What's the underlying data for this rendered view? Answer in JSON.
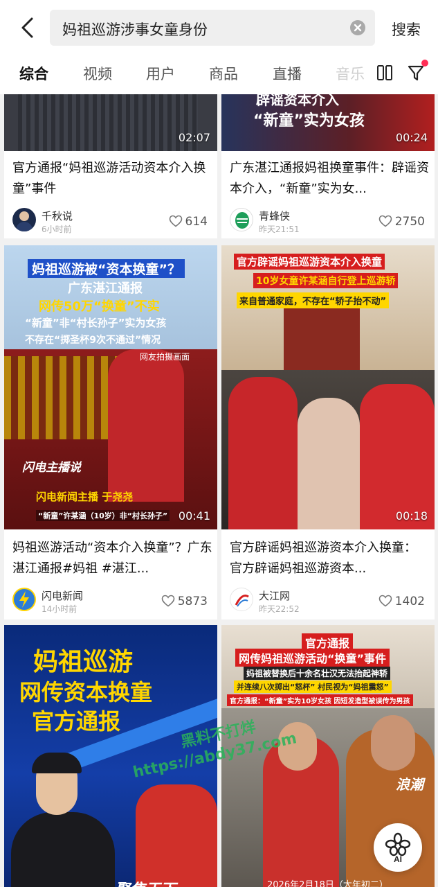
{
  "header": {
    "search_query": "妈祖巡游涉事女童身份",
    "search_button": "搜索"
  },
  "tabs": [
    "综合",
    "视频",
    "用户",
    "商品",
    "直播",
    "音乐"
  ],
  "cards": [
    {
      "duration": "02:07",
      "title": "官方通报“妈祖巡游活动资本介入换童”事件",
      "author": "千秋说",
      "time": "6小时前",
      "likes": "614"
    },
    {
      "duration": "00:24",
      "overlay": [
        "辟谣资本介入",
        "“新童”实为女孩"
      ],
      "title": "广东湛江通报妈祖换童事件：辟谣资本介入，“新童”实为女...",
      "author": "青蜂侠",
      "time": "昨天21:51",
      "likes": "2750"
    },
    {
      "duration": "00:41",
      "overlay": [
        "妈祖巡游被“资本换童”？",
        "广东湛江通报",
        "网传50万“换童”不实",
        "“新童”非“村长孙子”实为女孩",
        "不存在“掷圣杯9次不通过”情况",
        "网友拍摄画面",
        "闪电主播说",
        "闪电新闻主播 于尧尧",
        "“新童”许某涵（10岁）非“村长孙子”"
      ],
      "title": "妈祖巡游活动“资本介入换童”？广东湛江通报#妈祖 #湛江...",
      "author": "闪电新闻",
      "time": "14小时前",
      "likes": "5873"
    },
    {
      "duration": "00:18",
      "overlay": [
        "官方辟谣妈祖巡游资本介入换童",
        "10岁女童许某涵自行登上巡游轿",
        "来自普通家庭，不存在“轿子抬不动”"
      ],
      "title": "官方辟谣妈祖巡游资本介入换童： 官方辟谣妈祖巡游资本...",
      "author": "大江网",
      "time": "昨天22:52",
      "likes": "1402"
    },
    {
      "overlay": [
        "妈祖巡游",
        "网传资本换童",
        "官方通报",
        "聚焦天下"
      ]
    },
    {
      "overlay": [
        "官方通报",
        "网传妈祖巡游活动“换童”事件",
        "妈祖被替换后十余名壮汉无法抬起神轿",
        "并连续八次掷出“怒杯” 村民视为“妈祖震怒”",
        "官方通报：“新童”实为10岁女孩 因短发造型被误传为男孩",
        "浪潮",
        "2026年2月18日（大年初二）"
      ]
    }
  ],
  "watermark": [
    "黑料不打烊",
    "https://abdy37.com"
  ],
  "ai_button": "AI",
  "colors": {
    "accent_red": "#ff2d55",
    "banner_blue": "#1e50c8",
    "banner_yellow": "#ffd600",
    "banner_red": "#d61e1e"
  }
}
